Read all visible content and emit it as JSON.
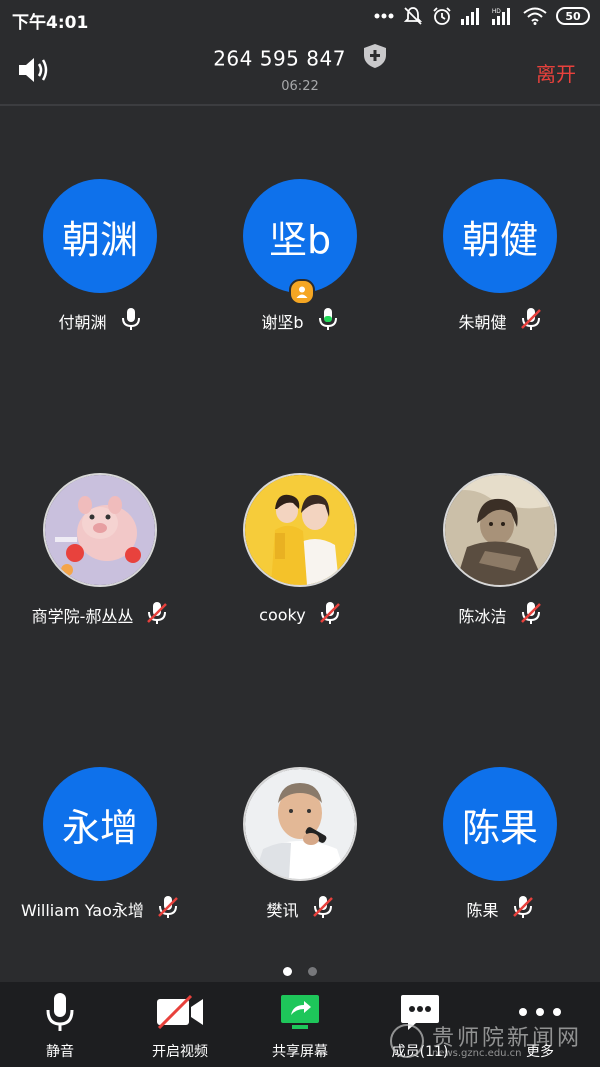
{
  "status": {
    "time": "下午4:01",
    "battery": "50"
  },
  "header": {
    "meeting_id": "264 595 847",
    "timer": "06:22",
    "leave_label": "离开"
  },
  "participants": [
    {
      "initials": "朝渊",
      "name": "付朝渊",
      "avatar": "initials",
      "mic": "on"
    },
    {
      "initials": "坚b",
      "name": "谢坚b",
      "avatar": "initials",
      "mic": "active",
      "host": true
    },
    {
      "initials": "朝健",
      "name": "朱朝健",
      "avatar": "initials",
      "mic": "muted"
    },
    {
      "initials": "",
      "name": "商学院-郝丛丛",
      "avatar": "photo-pig",
      "mic": "muted"
    },
    {
      "initials": "",
      "name": "cooky",
      "avatar": "photo-family",
      "mic": "muted"
    },
    {
      "initials": "",
      "name": "陈冰洁",
      "avatar": "photo-sepia",
      "mic": "muted"
    },
    {
      "initials": "永增",
      "name": "William Yao永增",
      "avatar": "initials",
      "mic": "muted"
    },
    {
      "initials": "",
      "name": "樊讯",
      "avatar": "photo-man",
      "mic": "muted"
    },
    {
      "initials": "陈果",
      "name": "陈果",
      "avatar": "initials",
      "mic": "muted"
    }
  ],
  "pagination": {
    "current": 1,
    "total": 2
  },
  "toolbar": {
    "mute": "静音",
    "start_video": "开启视频",
    "share_screen": "共享屏幕",
    "members": "成员(11)",
    "more": "更多"
  },
  "watermark": {
    "title": "贵师院新闻网",
    "url": "news.gznc.edu.cn"
  },
  "colors": {
    "avatar_blue": "#0e71eb",
    "leave_red": "#e8413c",
    "mic_active": "#23d959",
    "share_green": "#1ec65a",
    "host_badge": "#f5a623"
  }
}
